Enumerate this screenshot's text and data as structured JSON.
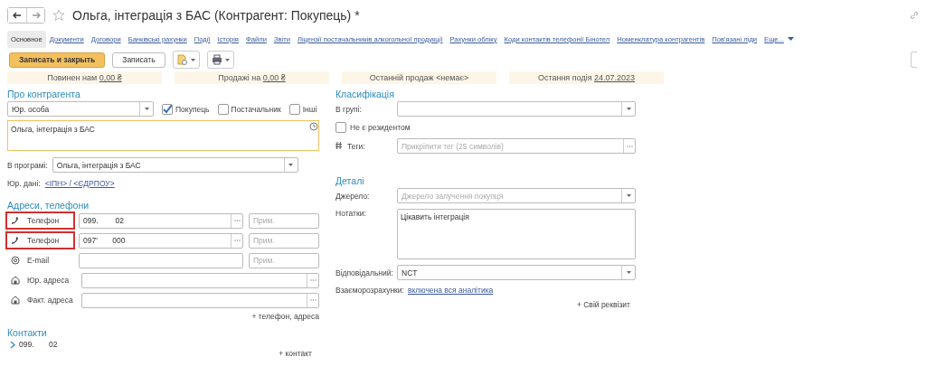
{
  "window": {
    "title": "Ольга, інтеграція з БАС (Контрагент: Покупець) *",
    "favorite": false
  },
  "tabs": [
    {
      "label": "Основное",
      "selected": true
    },
    {
      "label": "Документи",
      "selected": false
    },
    {
      "label": "Договори",
      "selected": false
    },
    {
      "label": "Банківські рахунки",
      "selected": false
    },
    {
      "label": "Події",
      "selected": false
    },
    {
      "label": "Історія",
      "selected": false
    },
    {
      "label": "Файли",
      "selected": false
    },
    {
      "label": "Звіти",
      "selected": false
    },
    {
      "label": "Ліцензії постачальників алкогольної продукції",
      "selected": false
    },
    {
      "label": "Рахунки обліку",
      "selected": false
    },
    {
      "label": "Коди контактів телефонії Бінотел",
      "selected": false
    },
    {
      "label": "Номенклатура контрагентів",
      "selected": false
    },
    {
      "label": "Пов'язані ліди",
      "selected": false
    },
    {
      "label": "Еще...",
      "selected": false
    }
  ],
  "toolbar": {
    "primary": "Записать и закрыть",
    "secondary": "Записать"
  },
  "summary": [
    {
      "label": "Повинен нам ",
      "value": "0,00 ₴"
    },
    {
      "label": "Продажі на ",
      "value": "0,00 ₴"
    },
    {
      "label": "Останній продаж <немає>"
    },
    {
      "label": "Остання подія ",
      "value": "24.07.2023"
    }
  ],
  "about": {
    "title": "Про контрагента",
    "type": "Юр. особа",
    "roles": [
      {
        "label": "Покупець",
        "checked": true
      },
      {
        "label": "Постачальник",
        "checked": false
      },
      {
        "label": "Інші",
        "checked": false
      }
    ],
    "name": "Ольга, інтеграція з БАС",
    "program_label": "В програмі:",
    "program": "Ольга, інтеграція з БАС",
    "legal_label": "Юр. дані:",
    "legal_link": "<ІПН> / <ЄДРПОУ>"
  },
  "addresses": {
    "title": "Адреси, телефони",
    "rows": [
      {
        "kind": "phone",
        "label": "Телефон",
        "value": "099.        02",
        "note_placeholder": "Прим.",
        "highlighted": true
      },
      {
        "kind": "phone",
        "label": "Телефон",
        "value": "097'       000",
        "note_placeholder": "Прим.",
        "highlighted": true
      },
      {
        "kind": "email",
        "label": "E-mail",
        "note_placeholder": "Прим.",
        "highlighted": false
      },
      {
        "kind": "address",
        "label": "Юр. адреса",
        "highlighted": false
      },
      {
        "kind": "address",
        "label": "Факт. адреса",
        "highlighted": false
      }
    ],
    "add": "+ телефон, адреса"
  },
  "contacts": {
    "title": "Контакти",
    "items": [
      {
        "label": "099.       02",
        "expanded": false
      }
    ],
    "add": "+ контакт"
  },
  "classification": {
    "title": "Класифікація",
    "group_label": "В групі:",
    "nonresident": {
      "label": "Не є резидентом",
      "checked": false
    },
    "tags_label": "Теги:",
    "tags_placeholder": "Прикріпити тег (25 символів)"
  },
  "details": {
    "title": "Деталі",
    "source_label": "Джерело:",
    "source_placeholder": "Джерело залучення покупця",
    "notes_label": "Нотатки:",
    "notes": "Цікавить інтеграція",
    "responsible_label": "Відповідальний:",
    "responsible": "NCT",
    "settlements_label": "Взаєморозрахунки:",
    "settlements_link": "включена вся аналітика",
    "add": "+ Свій реквізит"
  }
}
